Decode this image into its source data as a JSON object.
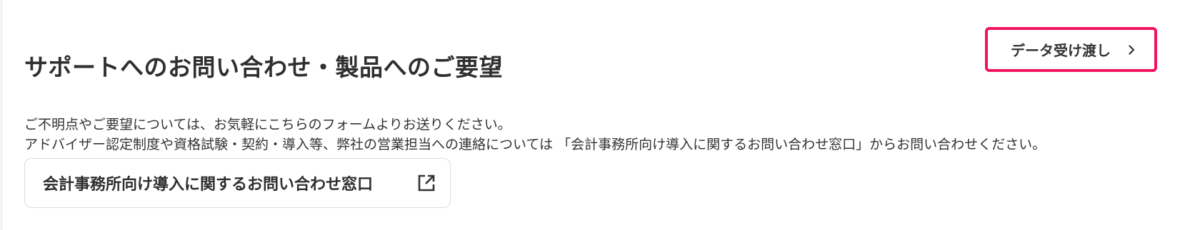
{
  "section": {
    "title": "サポートへのお問い合わせ・製品へのご要望",
    "data_transfer_button": {
      "label": "データ受け渡し",
      "icon": "chevron-right-icon"
    },
    "description": {
      "line1": "ご不明点やご要望については、お気軽にこちらのフォームよりお送りください。",
      "line2": "アドバイザー認定制度や資格試験・契約・導入等、弊社の営業担当への連絡については 「会計事務所向け導入に関するお問い合わせ窓口」からお問い合わせください。"
    },
    "contact_link": {
      "label": "会計事務所向け導入に関するお問い合わせ窓口",
      "icon": "external-link-icon"
    }
  },
  "colors": {
    "highlight_border": "#f0145a",
    "text": "#333333",
    "card_border": "#dcdcdc"
  }
}
